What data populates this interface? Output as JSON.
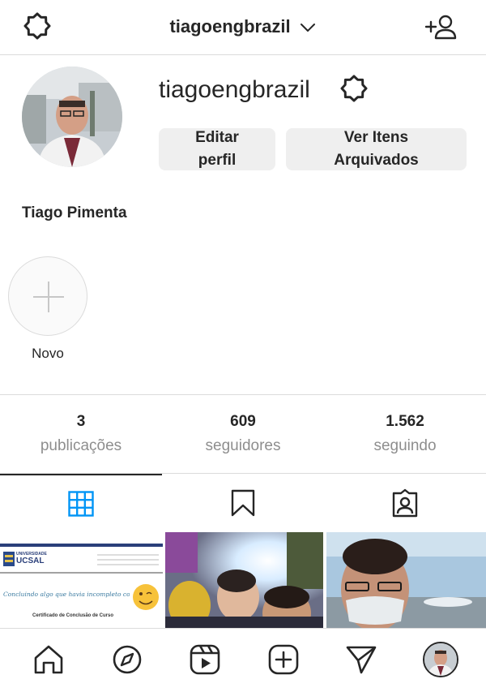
{
  "header": {
    "username": "tiagoengbrazil",
    "settings_icon": "settings-gear-icon",
    "dropdown_icon": "chevron-down-icon",
    "add_user_icon": "add-person-icon"
  },
  "profile": {
    "username": "tiagoengbrazil",
    "full_name": "Tiago Pimenta",
    "edit_button_line1": "Editar",
    "edit_button_line2": "perfil",
    "archive_button_line1": "Ver Itens",
    "archive_button_line2": "Arquivados"
  },
  "highlights": {
    "new_label": "Novo"
  },
  "stats": [
    {
      "value": "3",
      "label": "publicações"
    },
    {
      "value": "609",
      "label": "seguidores"
    },
    {
      "value": "1.562",
      "label": "seguindo"
    }
  ],
  "tabs": [
    {
      "name": "posts-grid",
      "icon": "grid-icon",
      "active": true
    },
    {
      "name": "saved",
      "icon": "bookmark-icon",
      "active": false
    },
    {
      "name": "tagged",
      "icon": "tagged-person-icon",
      "active": false
    }
  ],
  "posts": [
    {
      "kind": "certificate",
      "logo_line1": "UNIVERSIDADE",
      "logo_line2": "UCSAL",
      "script_text": "Concluindo algo que havia incompleto começado",
      "caption": "Certificado de Conclusão de Curso"
    },
    {
      "kind": "photo-crowd"
    },
    {
      "kind": "photo-airport"
    }
  ],
  "bottom_nav": [
    {
      "name": "home",
      "icon": "home-icon"
    },
    {
      "name": "explore",
      "icon": "compass-icon"
    },
    {
      "name": "reels",
      "icon": "reels-icon"
    },
    {
      "name": "new-post",
      "icon": "plus-square-icon"
    },
    {
      "name": "direct",
      "icon": "paper-plane-icon"
    },
    {
      "name": "profile",
      "icon": "avatar"
    }
  ],
  "colors": {
    "accent": "#0095f6",
    "text": "#262626",
    "secondary_text": "#8e8e8e",
    "button_bg": "#efefef",
    "divider": "#dbdbdb"
  }
}
